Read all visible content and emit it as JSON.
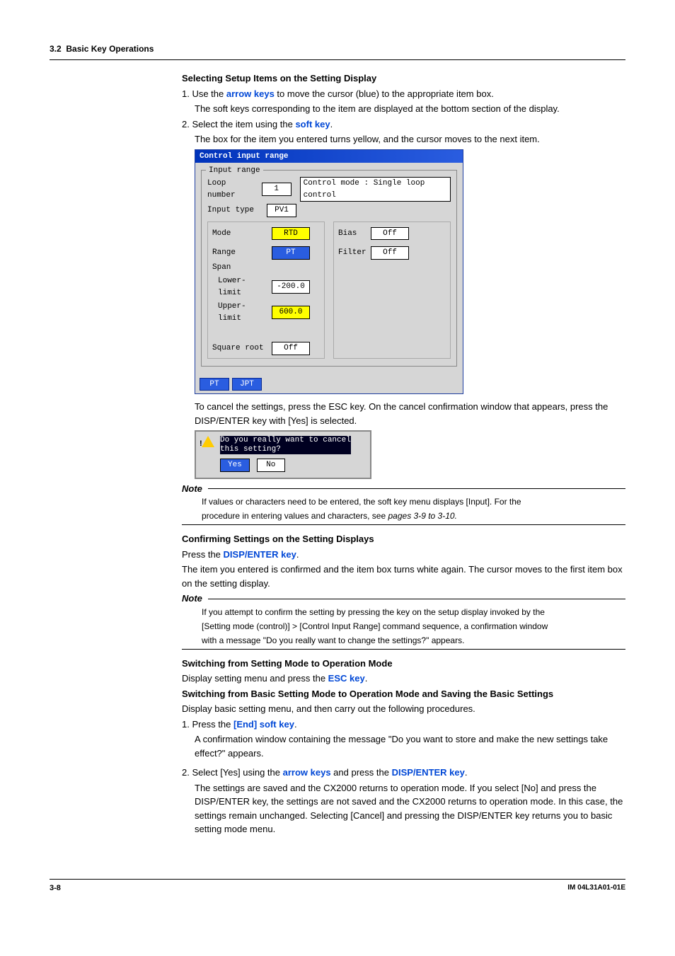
{
  "header": {
    "section_num": "3.2",
    "section_title": "Basic Key Operations"
  },
  "s1": {
    "title": "Selecting Setup Items on the Setting Display",
    "step1_pre": "1. Use the ",
    "step1_key": "arrow keys",
    "step1_post": " to move the cursor (blue) to the appropriate item box.",
    "step1_sub": "The soft keys corresponding to the item are displayed at the bottom section of the display.",
    "step2_pre": "2. Select the item using the ",
    "step2_key": "soft key",
    "step2_post": ".",
    "step2_sub": "The box for the item you entered turns yellow, and the cursor moves to the next item.",
    "cancel_text": "To cancel the settings, press the ESC key.  On the cancel confirmation window that appears, press the DISP/ENTER key with [Yes] is selected."
  },
  "lcd": {
    "title": "Control input range",
    "legend": "Input range",
    "right_info": "Control mode : Single loop control",
    "loop_lbl": "Loop number",
    "loop_val": "1",
    "itype_lbl": "Input type",
    "itype_val": "PV1",
    "mode_lbl": "Mode",
    "mode_val": "RTD",
    "bias_lbl": "Bias",
    "bias_val": "Off",
    "range_lbl": "Range",
    "range_val": "PT",
    "filter_lbl": "Filter",
    "filter_val": "Off",
    "span_lbl": "Span",
    "lower_lbl": "Lower-limit",
    "lower_val": "-200.0",
    "upper_lbl": "Upper-limit",
    "upper_val": "600.0",
    "sqrt_lbl": "Square root",
    "sqrt_val": "Off",
    "softkey1": "PT",
    "softkey2": "JPT"
  },
  "dialog": {
    "msg1": "Do you really want to cancel",
    "msg2": "this setting?",
    "yes": "Yes",
    "no": "No"
  },
  "note1": {
    "label": "Note",
    "line1": "If values or characters need to be entered, the soft key menu displays [Input].  For the",
    "line2_pre": "procedure in entering values and characters, see ",
    "line2_ref": "pages 3-9 to 3-10."
  },
  "s2": {
    "title": "Confirming Settings on the Setting Displays",
    "l1_pre": "Press the ",
    "l1_key": "DISP/ENTER key",
    "l1_post": ".",
    "l2": "The item you entered is confirmed and the item box turns white again.  The cursor moves to the first item box on the setting display."
  },
  "note2": {
    "label": "Note",
    "line1": "If you attempt to confirm the setting by pressing the key on the setup display invoked by the",
    "line2": "[Setting mode (control)] > [Control Input Range] command sequence, a confirmation window",
    "line3": "with a message \"Do you really want to change the settings?\" appears."
  },
  "s3": {
    "title": "Switching from Setting Mode to Operation Mode",
    "l1_pre": "Display setting menu and press the ",
    "l1_key": "ESC key",
    "l1_post": "."
  },
  "s4": {
    "title": "Switching from Basic Setting Mode to Operation Mode and Saving the Basic Settings",
    "intro": "Display basic setting menu, and then carry out the following procedures.",
    "step1_pre": "1. Press the ",
    "step1_key": "[End] soft key",
    "step1_post": ".",
    "step1_sub": "A confirmation window containing the message \"Do you want to store and make the new settings take effect?\" appears.",
    "step2_pre": "2. Select [Yes] using the ",
    "step2_key1": "arrow keys",
    "step2_mid": " and press the ",
    "step2_key2": "DISP/ENTER key",
    "step2_post": ".",
    "step2_sub": "The settings are saved and the CX2000 returns to operation mode.  If you select [No] and press the DISP/ENTER key, the settings are not saved and the CX2000 returns to operation mode.  In this case, the settings remain unchanged. Selecting [Cancel] and pressing the DISP/ENTER key returns you to basic setting mode menu."
  },
  "footer": {
    "page": "3-8",
    "manual": "IM 04L31A01-01E"
  }
}
